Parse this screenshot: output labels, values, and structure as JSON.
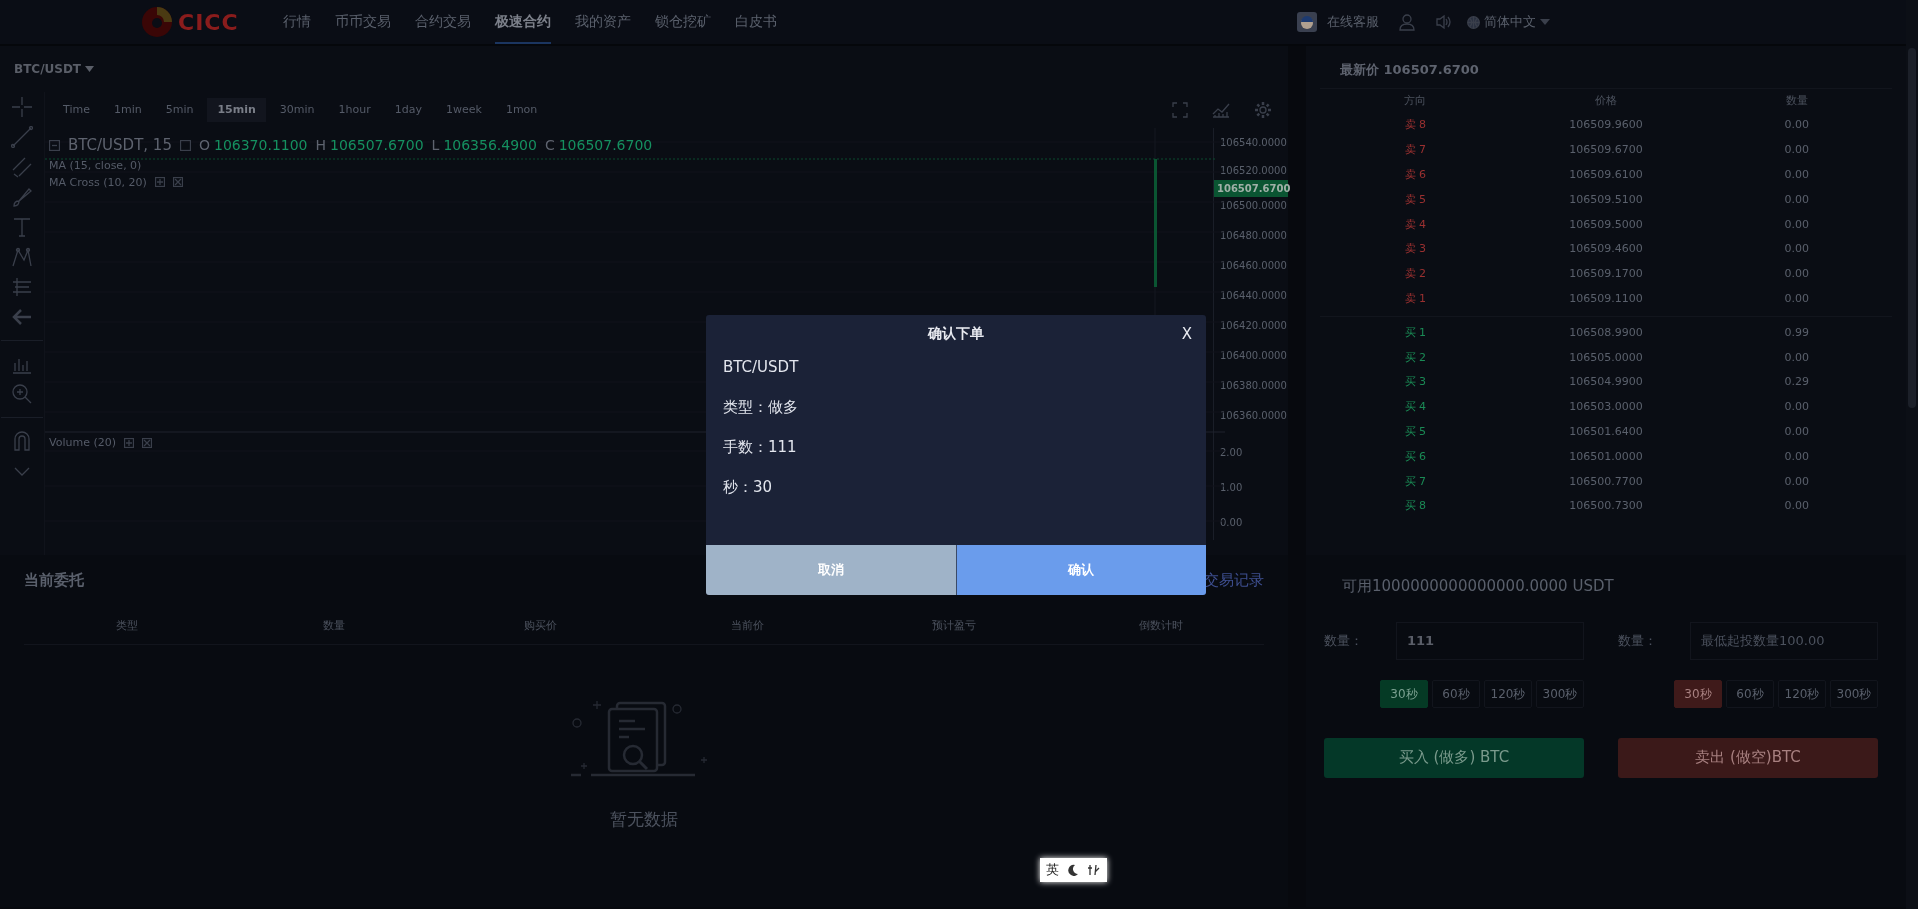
{
  "nav": {
    "brand": "CICC",
    "items": [
      {
        "label": "行情",
        "selected": false
      },
      {
        "label": "币币交易",
        "selected": false
      },
      {
        "label": "合约交易",
        "selected": false
      },
      {
        "label": "极速合约",
        "selected": true
      },
      {
        "label": "我的资产",
        "selected": false
      },
      {
        "label": "锁仓挖矿",
        "selected": false
      },
      {
        "label": "白皮书",
        "selected": false
      }
    ],
    "support": "在线客服",
    "language": "简体中文"
  },
  "chart": {
    "symbol": "BTC/USDT",
    "intervals": [
      {
        "label": "Time",
        "selected": false
      },
      {
        "label": "1min",
        "selected": false
      },
      {
        "label": "5min",
        "selected": false
      },
      {
        "label": "15min",
        "selected": true
      },
      {
        "label": "30min",
        "selected": false
      },
      {
        "label": "1hour",
        "selected": false
      },
      {
        "label": "1day",
        "selected": false
      },
      {
        "label": "1week",
        "selected": false
      },
      {
        "label": "1mon",
        "selected": false
      }
    ],
    "legend_title": "BTC/USDT, 15",
    "ohlc": [
      {
        "key": "O",
        "value": "106370.1100"
      },
      {
        "key": "H",
        "value": "106507.6700"
      },
      {
        "key": "L",
        "value": "106356.4900"
      },
      {
        "key": "C",
        "value": "106507.6700"
      }
    ],
    "studies": [
      "MA (15, close, 0)",
      "MA Cross (10, 20)"
    ],
    "volume_label": "Volume (20)",
    "price_labels": [
      "106540.0000",
      "106520.0000",
      "106500.0000",
      "106480.0000",
      "106460.0000",
      "106440.0000",
      "106420.0000",
      "106400.0000",
      "106380.0000",
      "106360.0000"
    ],
    "last_price_tag": "106507.6700",
    "volume_labels": [
      "2.00",
      "1.00",
      "0.00"
    ]
  },
  "order_book": {
    "title": "最新价 106507.6700",
    "columns": [
      "方向",
      "价格",
      "数量"
    ],
    "asks": [
      {
        "side": "卖 8",
        "price": "106509.9600",
        "amount": "0.00"
      },
      {
        "side": "卖 7",
        "price": "106509.6700",
        "amount": "0.00"
      },
      {
        "side": "卖 6",
        "price": "106509.6100",
        "amount": "0.00"
      },
      {
        "side": "卖 5",
        "price": "106509.5100",
        "amount": "0.00"
      },
      {
        "side": "卖 4",
        "price": "106509.5000",
        "amount": "0.00"
      },
      {
        "side": "卖 3",
        "price": "106509.4600",
        "amount": "0.00"
      },
      {
        "side": "卖 2",
        "price": "106509.1700",
        "amount": "0.00"
      },
      {
        "side": "卖 1",
        "price": "106509.1100",
        "amount": "0.00"
      }
    ],
    "bids": [
      {
        "side": "买 1",
        "price": "106508.9900",
        "amount": "0.99"
      },
      {
        "side": "买 2",
        "price": "106505.0000",
        "amount": "0.00"
      },
      {
        "side": "买 3",
        "price": "106504.9900",
        "amount": "0.29"
      },
      {
        "side": "买 4",
        "price": "106503.0000",
        "amount": "0.00"
      },
      {
        "side": "买 5",
        "price": "106501.6400",
        "amount": "0.00"
      },
      {
        "side": "买 6",
        "price": "106501.0000",
        "amount": "0.00"
      },
      {
        "side": "买 7",
        "price": "106500.7700",
        "amount": "0.00"
      },
      {
        "side": "买 8",
        "price": "106500.7300",
        "amount": "0.00"
      }
    ]
  },
  "orders": {
    "title": "当前委托",
    "history_link": "交易记录",
    "columns": [
      "类型",
      "数量",
      "购买价",
      "当前价",
      "预计盈亏",
      "倒数计时"
    ],
    "empty_text": "暂无数据"
  },
  "trade": {
    "available": "可用1000000000000000.0000 USDT",
    "buy": {
      "label": "数量：",
      "value": "111",
      "durations": [
        {
          "label": "30秒",
          "selected": true
        },
        {
          "label": "60秒",
          "selected": false
        },
        {
          "label": "120秒",
          "selected": false
        },
        {
          "label": "300秒",
          "selected": false
        }
      ],
      "button": "买入 (做多) BTC"
    },
    "sell": {
      "label": "数量：",
      "placeholder": "最低起投数量100.00",
      "durations": [
        {
          "label": "30秒",
          "selected": true
        },
        {
          "label": "60秒",
          "selected": false
        },
        {
          "label": "120秒",
          "selected": false
        },
        {
          "label": "300秒",
          "selected": false
        }
      ],
      "button": "卖出 (做空)BTC"
    }
  },
  "dialog": {
    "title": "确认下单",
    "close": "X",
    "lines": [
      "BTC/USDT",
      "类型：做多",
      "手数：111",
      "秒：30"
    ],
    "buttons": [
      {
        "label": "取消",
        "kind": "cancel"
      },
      {
        "label": "确认",
        "kind": "confirm"
      }
    ]
  },
  "ime": {
    "mode": "英"
  }
}
